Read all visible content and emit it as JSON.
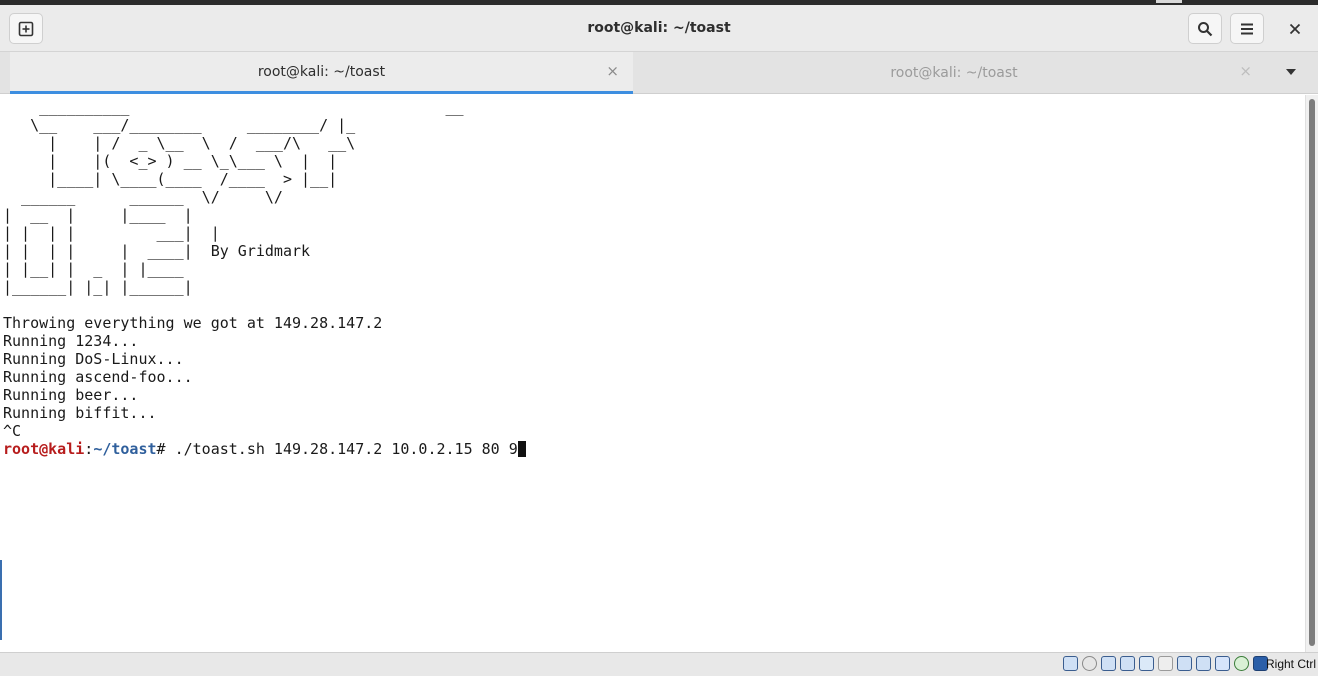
{
  "window": {
    "title": "root@kali: ~/toast"
  },
  "tabs": [
    {
      "label": "root@kali: ~/toast",
      "close": "×"
    },
    {
      "label": "root@kali: ~/toast",
      "close": "×"
    }
  ],
  "terminal": {
    "banner": "    __________                                   __\n   \\__    ___/________     ________/ |_\n     |    | /  _ \\__  \\  /  ___/\\   __\\\n     |    |(  <_> ) __ \\_\\___ \\  |  |\n     |____| \\____(____  /____  > |__|\n  ______      ______  \\/     \\/\n|  __  |     |____  |\n| |  | |         ___|  |\n| |  | |     |  ____|  By Gridmark\n| |__| |  _  | |____\n|______| |_| |______|",
    "output": "Throwing everything we got at 149.28.147.2\nRunning 1234...\nRunning DoS-Linux...\nRunning ascend-foo...\nRunning beer...\nRunning biffit...\n^C",
    "prompt_user": "root@kali",
    "prompt_sep": ":",
    "prompt_path": "~/toast",
    "prompt_symbol": "# ",
    "command": "./toast.sh 149.28.147.2 10.0.2.15 80 9"
  },
  "statusbar": {
    "host_key": "Right Ctrl"
  },
  "colors": {
    "prompt_user": "#b71c1c",
    "prompt_path": "#2f5f9c",
    "active_tab_indicator": "#3d8ee0"
  }
}
